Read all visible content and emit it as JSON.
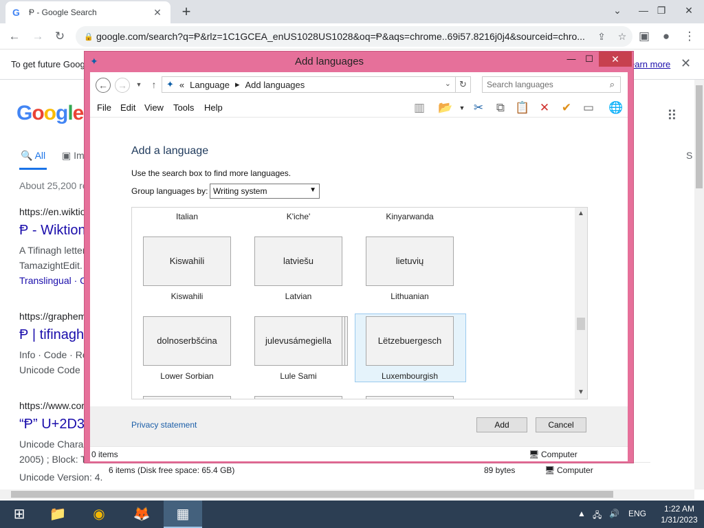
{
  "browser": {
    "tab_title": "Ᵽ - Google Search",
    "tab_favicon": "G",
    "url": "google.com/search?q=Ᵽ&rlz=1C1GCEA_enUS1028US1028&oq=Ᵽ&aqs=chrome..69i57.8216j0j4&sourceid=chro...",
    "infobar_text": "To get future Goog",
    "infobar_link": "earn more"
  },
  "google": {
    "logo": "Google",
    "tab_all": "All",
    "tab_images": "Im",
    "tab_s": "S",
    "stats": "About 25,200 re",
    "results": [
      {
        "url": "https://en.wiktio",
        "title": "Ᵽ - Wiktion",
        "snippet1": "A Tifinagh letter",
        "snippet2": "TamazightEdit.",
        "link": "Translingual · C"
      },
      {
        "url": "https://graphem",
        "title": "Ᵽ | tifinagh",
        "snippet1": "Info · Code · Re",
        "snippet2": "Unicode Code"
      },
      {
        "url": "https://www.cor",
        "title": "“Ᵽ” U+2D3",
        "snippet1": "Unicode Chara",
        "snippet2": "2005) ; Block: T",
        "snippet3": "Unicode Version: 4."
      }
    ]
  },
  "bg_status": {
    "items": "6 items (Disk free space: 65.4 GB)",
    "size": "89 bytes",
    "location": "Computer"
  },
  "dialog": {
    "title": "Add languages",
    "breadcrumb": [
      "Language",
      "Add languages"
    ],
    "breadcrumb_prefix": "«",
    "search_placeholder": "Search languages",
    "menu": [
      "File",
      "Edit",
      "View",
      "Tools",
      "Help"
    ],
    "heading": "Add a language",
    "hint": "Use the search box to find more languages.",
    "group_label": "Group languages by:",
    "group_value": "Writing system",
    "top_labels": [
      "Italian",
      "K'iche'",
      "Kinyarwanda"
    ],
    "row1": [
      {
        "native": "Kiswahili",
        "english": "Kiswahili"
      },
      {
        "native": "latviešu",
        "english": "Latvian"
      },
      {
        "native": "lietuvių",
        "english": "Lithuanian"
      }
    ],
    "row2": [
      {
        "native": "dolnoserbšćina",
        "english": "Lower Sorbian"
      },
      {
        "native": "julevusámegiella",
        "english": "Lule Sami"
      },
      {
        "native": "Lëtzebuergesch",
        "english": "Luxembourgish"
      }
    ],
    "privacy": "Privacy statement",
    "add": "Add",
    "cancel": "Cancel",
    "status_items": "0 items",
    "status_location": "Computer"
  },
  "taskbar": {
    "lang": "ENG",
    "time": "1:22 AM",
    "date": "1/31/2023"
  }
}
